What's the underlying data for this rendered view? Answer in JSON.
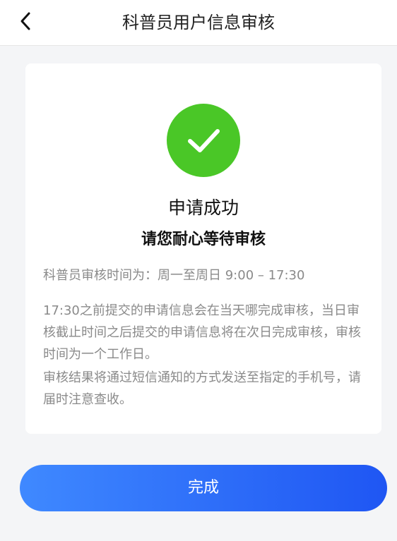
{
  "nav": {
    "title": "科普员用户信息审核",
    "back_icon": "chevron-left-icon"
  },
  "result": {
    "status_icon": "check-circle-icon",
    "status_color": "#4ac727",
    "title": "申请成功",
    "subtitle": "请您耐心等待审核",
    "schedule": "科普员审核时间为：周一至周日 9:00 – 17:30",
    "detail": "17:30之前提交的申请信息会在当天哪完成审核，当日审核截止时间之后提交的申请信息将在次日完成审核，审核时间为一个工作日。",
    "notice": "审核结果将通过短信通知的方式发送至指定的手机号，请届时注意查收。"
  },
  "actions": {
    "done_label": "完成",
    "button_color": "#2f6dfb"
  }
}
